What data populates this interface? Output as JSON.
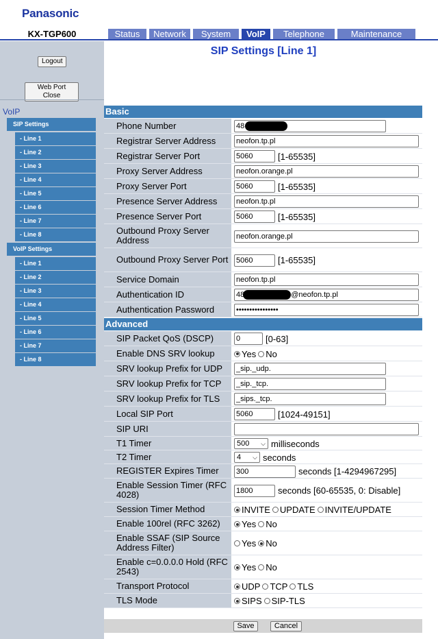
{
  "brand": "Panasonic",
  "model": "KX-TGP600",
  "tabs": [
    {
      "label": "Status"
    },
    {
      "label": "Network"
    },
    {
      "label": "System"
    },
    {
      "label": "VoIP"
    },
    {
      "label": "Telephone"
    },
    {
      "label": "Maintenance"
    }
  ],
  "sidebar": {
    "logout": "Logout",
    "web_port_close": "Web Port Close",
    "section": "VoIP",
    "sip_settings": "SIP Settings",
    "sip_lines": [
      "- Line 1",
      "- Line 2",
      "- Line 3",
      "- Line 4",
      "- Line 5",
      "- Line 6",
      "- Line 7",
      "- Line 8"
    ],
    "voip_settings": "VoIP Settings",
    "voip_lines": [
      "- Line 1",
      "- Line 2",
      "- Line 3",
      "- Line 4",
      "- Line 5",
      "- Line 6",
      "- Line 7",
      "- Line 8"
    ]
  },
  "page_title": "SIP Settings [Line 1]",
  "basic": {
    "header": "Basic",
    "phone_number_label": "Phone Number",
    "phone_number_prefix": "48",
    "registrar_address_label": "Registrar Server Address",
    "registrar_address": "neofon.tp.pl",
    "registrar_port_label": "Registrar Server Port",
    "registrar_port": "5060",
    "port_range": "[1-65535]",
    "proxy_address_label": "Proxy Server Address",
    "proxy_address": "neofon.orange.pl",
    "proxy_port_label": "Proxy Server Port",
    "proxy_port": "5060",
    "presence_address_label": "Presence Server Address",
    "presence_address": "neofon.tp.pl",
    "presence_port_label": "Presence Server Port",
    "presence_port": "5060",
    "outbound_address_label": "Outbound Proxy Server Address",
    "outbound_address": "neofon.orange.pl",
    "outbound_port_label": "Outbound Proxy Server Port",
    "outbound_port": "5060",
    "service_domain_label": "Service Domain",
    "service_domain": "neofon.tp.pl",
    "auth_id_label": "Authentication ID",
    "auth_id_prefix": "48",
    "auth_id_suffix": "@neofon.tp.pl",
    "auth_password_label": "Authentication Password",
    "auth_password": "••••••••••••••••"
  },
  "advanced": {
    "header": "Advanced",
    "qos_label": "SIP Packet QoS (DSCP)",
    "qos_value": "0",
    "qos_range": "[0-63]",
    "dns_srv_label": "Enable DNS SRV lookup",
    "yes": "Yes",
    "no": "No",
    "srv_udp_label": "SRV lookup Prefix for UDP",
    "srv_udp": "_sip._udp.",
    "srv_tcp_label": "SRV lookup Prefix for TCP",
    "srv_tcp": "_sip._tcp.",
    "srv_tls_label": "SRV lookup Prefix for TLS",
    "srv_tls": "_sips._tcp.",
    "local_port_label": "Local SIP Port",
    "local_port": "5060",
    "local_port_range": "[1024-49151]",
    "sip_uri_label": "SIP URI",
    "sip_uri": "",
    "t1_label": "T1 Timer",
    "t1_value": "500",
    "t1_unit": "milliseconds",
    "t2_label": "T2 Timer",
    "t2_value": "4",
    "t2_unit": "seconds",
    "register_label": "REGISTER Expires Timer",
    "register_value": "300",
    "register_hint": "seconds [1-4294967295]",
    "session_timer_label": "Enable Session Timer (RFC 4028)",
    "session_timer_value": "1800",
    "session_timer_hint": "seconds [60-65535, 0: Disable]",
    "session_method_label": "Session Timer Method",
    "method_invite": "INVITE",
    "method_update": "UPDATE",
    "method_both": "INVITE/UPDATE",
    "rel100_label": "Enable 100rel (RFC 3262)",
    "ssaf_label": "Enable SSAF (SIP Source Address Filter)",
    "hold_label": "Enable c=0.0.0.0 Hold (RFC 2543)",
    "transport_label": "Transport Protocol",
    "t_udp": "UDP",
    "t_tcp": "TCP",
    "t_tls": "TLS",
    "tls_mode_label": "TLS Mode",
    "tls_sips": "SIPS",
    "tls_siptls": "SIP-TLS"
  },
  "buttons": {
    "save": "Save",
    "cancel": "Cancel"
  }
}
